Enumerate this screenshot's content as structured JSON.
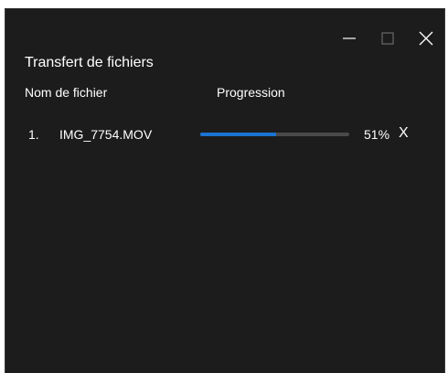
{
  "window": {
    "title": "Transfert de fichiers",
    "controls": {
      "minimize": "minimize-icon",
      "maximize": "maximize-icon",
      "close": "close-icon"
    }
  },
  "table": {
    "headers": {
      "file": "Nom de fichier",
      "progress": "Progression"
    },
    "rows": [
      {
        "index": "1.",
        "name": "IMG_7754.MOV",
        "progress": 0.51,
        "percent_text": "51%",
        "cancel": "X"
      }
    ]
  },
  "colors": {
    "background": "#1c1c1c",
    "progress_fill": "#1a73d1",
    "progress_track": "#4a4a4a",
    "text": "#ffffff"
  }
}
